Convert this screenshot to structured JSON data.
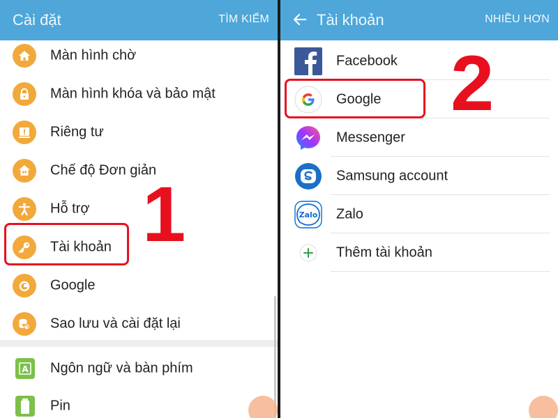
{
  "left": {
    "header": {
      "title": "Cài đặt",
      "action": "TÌM KIẾM"
    },
    "items": [
      {
        "label": "Màn hình chờ",
        "icon": "home-icon"
      },
      {
        "label": "Màn hình khóa và bảo mật",
        "icon": "lock-icon"
      },
      {
        "label": "Riêng tư",
        "icon": "privacy-icon"
      },
      {
        "label": "Chế độ Đơn giản",
        "icon": "easy-mode-icon"
      },
      {
        "label": "Hỗ trợ",
        "icon": "accessibility-icon"
      },
      {
        "label": "Tài khoản",
        "icon": "key-icon"
      },
      {
        "label": "Google",
        "icon": "google-g-icon"
      },
      {
        "label": "Sao lưu và cài đặt lại",
        "icon": "backup-icon"
      },
      {
        "label": "Ngôn ngữ và bàn phím",
        "icon": "language-icon"
      },
      {
        "label": "Pin",
        "icon": "battery-icon"
      }
    ],
    "step_number": "1"
  },
  "right": {
    "header": {
      "title": "Tài khoản",
      "action": "NHIỀU HƠN"
    },
    "items": [
      {
        "label": "Facebook",
        "icon": "facebook-icon"
      },
      {
        "label": "Google",
        "icon": "google-icon"
      },
      {
        "label": "Messenger",
        "icon": "messenger-icon"
      },
      {
        "label": "Samsung account",
        "icon": "samsung-account-icon"
      },
      {
        "label": "Zalo",
        "icon": "zalo-icon",
        "icon_text": "Zalo"
      },
      {
        "label": "Thêm tài khoản",
        "icon": "plus-icon"
      }
    ],
    "step_number": "2"
  },
  "colors": {
    "header": "#4ea6d9",
    "settings_icon": "#f2a93b",
    "highlight": "#e8101e",
    "facebook": "#3b5998",
    "messenger": "#7b4cff",
    "samsung": "#1a6fc7",
    "zalo": "#0b6bd6",
    "plus": "#2f9e44"
  }
}
